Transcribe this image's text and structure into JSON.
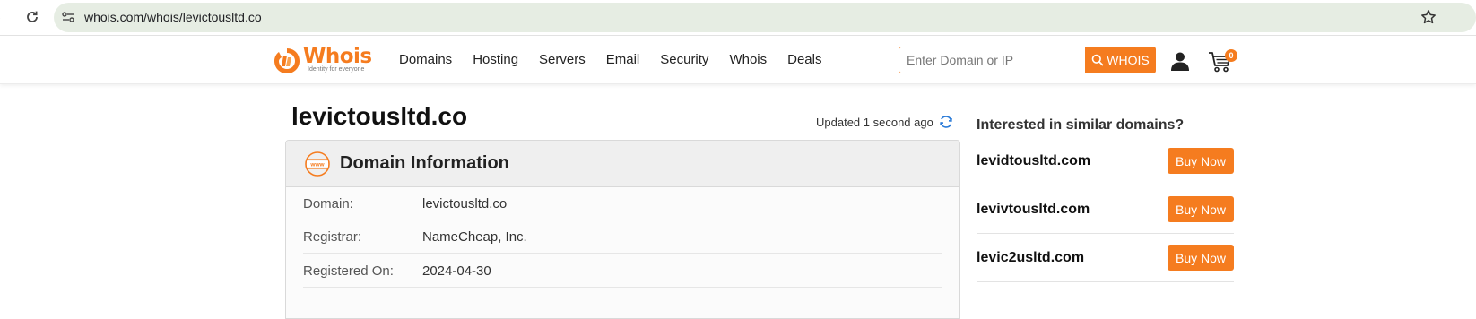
{
  "browser": {
    "url": "whois.com/whois/levictousltd.co",
    "icons": [
      "forward-icon",
      "reload-icon",
      "site-settings-icon",
      "bookmark-star-icon"
    ]
  },
  "header": {
    "logo_text": "Whois",
    "logo_tagline": "Identity for everyone",
    "nav": [
      {
        "label": "Domains"
      },
      {
        "label": "Hosting"
      },
      {
        "label": "Servers"
      },
      {
        "label": "Email"
      },
      {
        "label": "Security"
      },
      {
        "label": "Whois"
      },
      {
        "label": "Deals"
      }
    ],
    "search_placeholder": "Enter Domain or IP",
    "search_button": "WHOIS",
    "cart_count": "0"
  },
  "main": {
    "domain_title": "levictousltd.co",
    "updated": "Updated 1 second ago",
    "panel_title": "Domain Information",
    "www_icon_text": "www",
    "rows": [
      {
        "label": "Domain:",
        "value": "levictousltd.co"
      },
      {
        "label": "Registrar:",
        "value": "NameCheap, Inc."
      },
      {
        "label": "Registered On:",
        "value": "2024-04-30"
      }
    ]
  },
  "sidebar": {
    "title": "Interested in similar domains?",
    "suggestions": [
      {
        "name": "levidtousltd.com",
        "button": "Buy Now"
      },
      {
        "name": "levivtousltd.com",
        "button": "Buy Now"
      },
      {
        "name": "levic2usltd.com",
        "button": "Buy Now"
      }
    ]
  },
  "colors": {
    "brand_orange": "#f57c1f",
    "omnibox_bg": "#e6ede3",
    "refresh_blue": "#2a7bd8"
  }
}
